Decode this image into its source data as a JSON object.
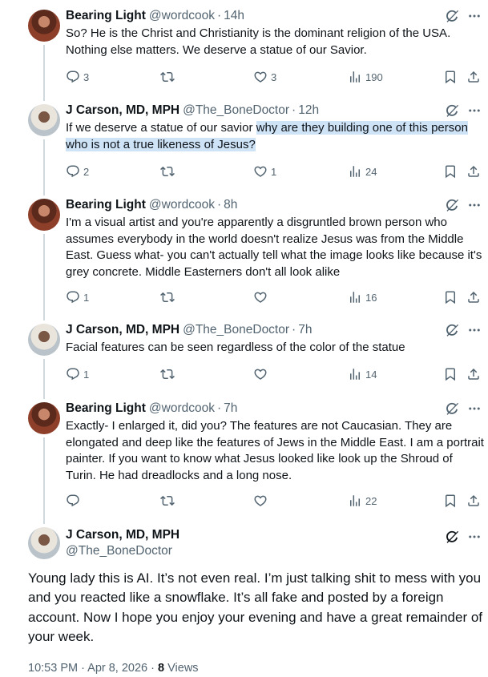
{
  "replies": [
    {
      "name": "Bearing Light",
      "handle": "@wordcook",
      "sep": "·",
      "time": "14h",
      "text": "So? He is the Christ and Christianity is the dominant religion of the USA. Nothing else matters. We deserve a statue of our Savior.",
      "reply_count": "3",
      "retweet_count": "",
      "like_count": "3",
      "view_count": "190"
    },
    {
      "name": "J Carson, MD, MPH",
      "handle": "@The_BoneDoctor",
      "sep": "·",
      "time": "12h",
      "text_plain": "If we deserve a statue of our savior ",
      "text_highlight": "why are they building one of this person who is not a true likeness of Jesus?",
      "reply_count": "2",
      "retweet_count": "",
      "like_count": "1",
      "view_count": "24"
    },
    {
      "name": "Bearing Light",
      "handle": "@wordcook",
      "sep": "·",
      "time": "8h",
      "text": "I'm a visual artist and you're apparently a disgruntled brown person who assumes everybody in the world doesn't realize Jesus was from the Middle East. Guess what- you can't actually tell what the image looks like because it's grey concrete. Middle Easterners don't all look alike",
      "reply_count": "1",
      "retweet_count": "",
      "like_count": "",
      "view_count": "16"
    },
    {
      "name": "J Carson, MD, MPH",
      "handle": "@The_BoneDoctor",
      "sep": "·",
      "time": "7h",
      "text": "Facial features can be seen regardless of the color of the statue",
      "reply_count": "1",
      "retweet_count": "",
      "like_count": "",
      "view_count": "14"
    },
    {
      "name": "Bearing Light",
      "handle": "@wordcook",
      "sep": "·",
      "time": "7h",
      "text": "Exactly- I enlarged it, did you? The features are not Caucasian. They are elongated and deep like the features of Jews in the Middle East. I am a portrait painter. If you want to know what Jesus looked like look up the Shroud of Turin. He had dreadlocks and a long nose.",
      "reply_count": "",
      "retweet_count": "",
      "like_count": "",
      "view_count": "22"
    }
  ],
  "main_tweet": {
    "name": "J Carson, MD, MPH",
    "handle": "@The_BoneDoctor",
    "text": "Young lady this is AI. It’s not even real. I’m just talking shit to mess with you and you reacted like a snowflake. It’s all fake and posted by a foreign account. Now I hope you enjoy your evening and have a great remainder of your week.",
    "timestamp": "10:53 PM · Apr 8, 2026 · ",
    "views_count": "8",
    "views_label": " Views"
  },
  "icons": {
    "reply": "reply-icon",
    "retweet": "retweet-icon",
    "like": "like-icon",
    "views": "views-icon",
    "bookmark": "bookmark-icon",
    "share": "share-icon",
    "grok": "grok-icon",
    "more": "more-icon"
  },
  "colors": {
    "text": "#0f1419",
    "secondary": "#536471",
    "thread_line": "#cfd9de",
    "highlight": "#cfe3f7"
  }
}
